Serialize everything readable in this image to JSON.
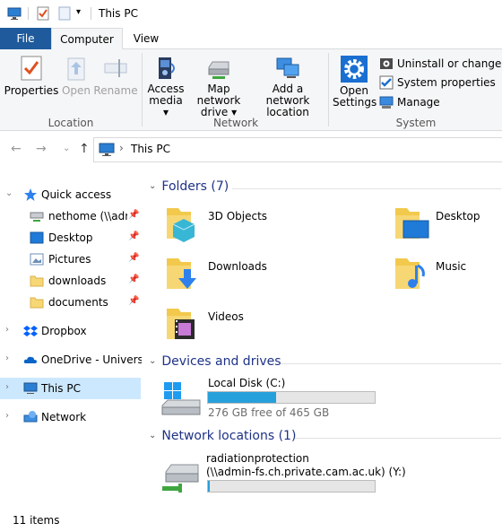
{
  "window": {
    "title": "This PC"
  },
  "tabs": [
    {
      "label": "File"
    },
    {
      "label": "Computer"
    },
    {
      "label": "View"
    }
  ],
  "ribbon": {
    "location": {
      "label": "Location",
      "buttons": [
        {
          "label": "Properties",
          "enabled": true
        },
        {
          "label": "Open",
          "enabled": false
        },
        {
          "label": "Rename",
          "enabled": false
        }
      ]
    },
    "network": {
      "label": "Network",
      "buttons": [
        {
          "label_line1": "Access",
          "label_line2": "media ▾"
        },
        {
          "label_line1": "Map network",
          "label_line2": "drive ▾"
        },
        {
          "label_line1": "Add a network",
          "label_line2": "location"
        }
      ]
    },
    "system": {
      "label": "System",
      "open_settings_line1": "Open",
      "open_settings_line2": "Settings",
      "items": [
        {
          "label": "Uninstall or change a p"
        },
        {
          "label": "System properties"
        },
        {
          "label": "Manage"
        }
      ]
    }
  },
  "address": {
    "path_item": "This PC",
    "separator": "›"
  },
  "sidebar": {
    "items": [
      {
        "label": "Quick access",
        "expander": "⌄",
        "icon": "star-icon"
      },
      {
        "label": "nethome (\\\\adm",
        "icon": "network-drive-icon",
        "pinned": true
      },
      {
        "label": "Desktop",
        "icon": "desktop-folder-icon",
        "pinned": true
      },
      {
        "label": "Pictures",
        "icon": "pictures-folder-icon",
        "pinned": true
      },
      {
        "label": "downloads",
        "icon": "folder-icon",
        "pinned": true
      },
      {
        "label": "documents",
        "icon": "folder-icon",
        "pinned": true
      },
      {
        "label": "Dropbox",
        "expander": "›",
        "icon": "dropbox-icon"
      },
      {
        "label": "OneDrive - University",
        "expander": "›",
        "icon": "onedrive-icon"
      },
      {
        "label": "This PC",
        "expander": "›",
        "icon": "computer-icon",
        "selected": true
      },
      {
        "label": "Network",
        "expander": "›",
        "icon": "network-icon"
      }
    ]
  },
  "content": {
    "folders_header": "Folders (7)",
    "folders": [
      {
        "label": "3D Objects",
        "icon": "3d-objects-folder-icon"
      },
      {
        "label": "Desktop",
        "icon": "desktop-folder-icon"
      },
      {
        "label": "Downloads",
        "icon": "downloads-folder-icon"
      },
      {
        "label": "Music",
        "icon": "music-folder-icon"
      },
      {
        "label": "Videos",
        "icon": "videos-folder-icon"
      }
    ],
    "devices_header": "Devices and drives",
    "drives": [
      {
        "label": "Local Disk (C:)",
        "free_text": "276 GB free of 465 GB",
        "used_fraction": 0.406
      }
    ],
    "network_header": "Network locations (1)",
    "network_locations": [
      {
        "label_line1": "radiationprotection",
        "label_line2": "(\\\\admin-fs.ch.private.cam.ac.uk) (Y:)",
        "used_fraction": 0.01
      }
    ]
  },
  "status": {
    "items_count": "11 items"
  },
  "colors": {
    "accent": "#1e5a9c",
    "header_blue": "#1e3287",
    "selection": "#cce8ff",
    "bar_fill": "#26a0da"
  }
}
